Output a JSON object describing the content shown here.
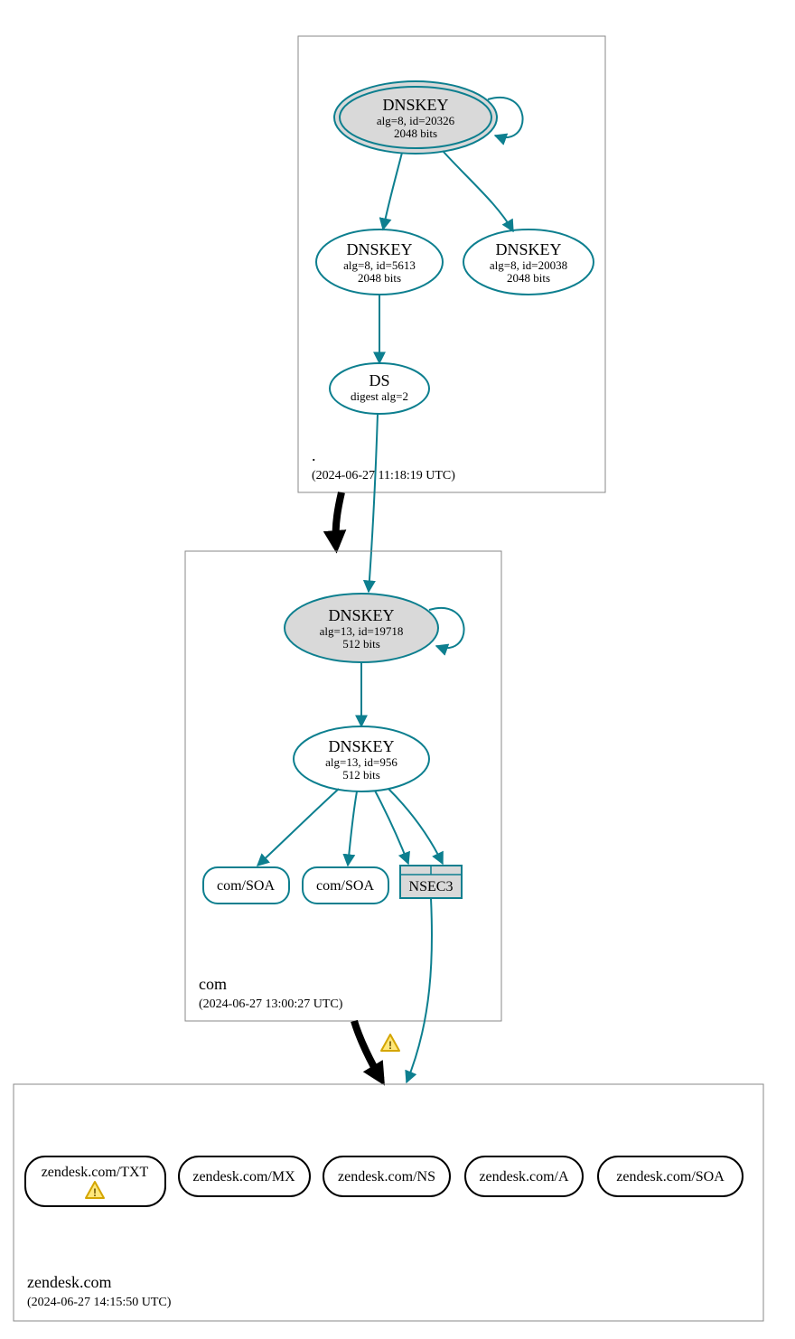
{
  "colors": {
    "teal": "#0d7f8f",
    "grayFill": "#d9d9d9",
    "boxStroke": "#888"
  },
  "zones": {
    "root": {
      "label": ".",
      "timestamp": "(2024-06-27 11:18:19 UTC)",
      "nodes": {
        "ksk": {
          "title": "DNSKEY",
          "alg": "alg=8, id=20326",
          "bits": "2048 bits"
        },
        "zsk1": {
          "title": "DNSKEY",
          "alg": "alg=8, id=5613",
          "bits": "2048 bits"
        },
        "zsk2": {
          "title": "DNSKEY",
          "alg": "alg=8, id=20038",
          "bits": "2048 bits"
        },
        "ds": {
          "title": "DS",
          "alg": "digest alg=2"
        }
      }
    },
    "com": {
      "label": "com",
      "timestamp": "(2024-06-27 13:00:27 UTC)",
      "nodes": {
        "ksk": {
          "title": "DNSKEY",
          "alg": "alg=13, id=19718",
          "bits": "512 bits"
        },
        "zsk": {
          "title": "DNSKEY",
          "alg": "alg=13, id=956",
          "bits": "512 bits"
        },
        "soa1": {
          "title": "com/SOA"
        },
        "soa2": {
          "title": "com/SOA"
        },
        "nsec3": {
          "title": "NSEC3"
        }
      }
    },
    "zendesk": {
      "label": "zendesk.com",
      "timestamp": "(2024-06-27 14:15:50 UTC)",
      "nodes": {
        "txt": {
          "title": "zendesk.com/TXT",
          "warn": true
        },
        "mx": {
          "title": "zendesk.com/MX"
        },
        "ns": {
          "title": "zendesk.com/NS"
        },
        "a": {
          "title": "zendesk.com/A"
        },
        "soa": {
          "title": "zendesk.com/SOA"
        }
      }
    }
  }
}
